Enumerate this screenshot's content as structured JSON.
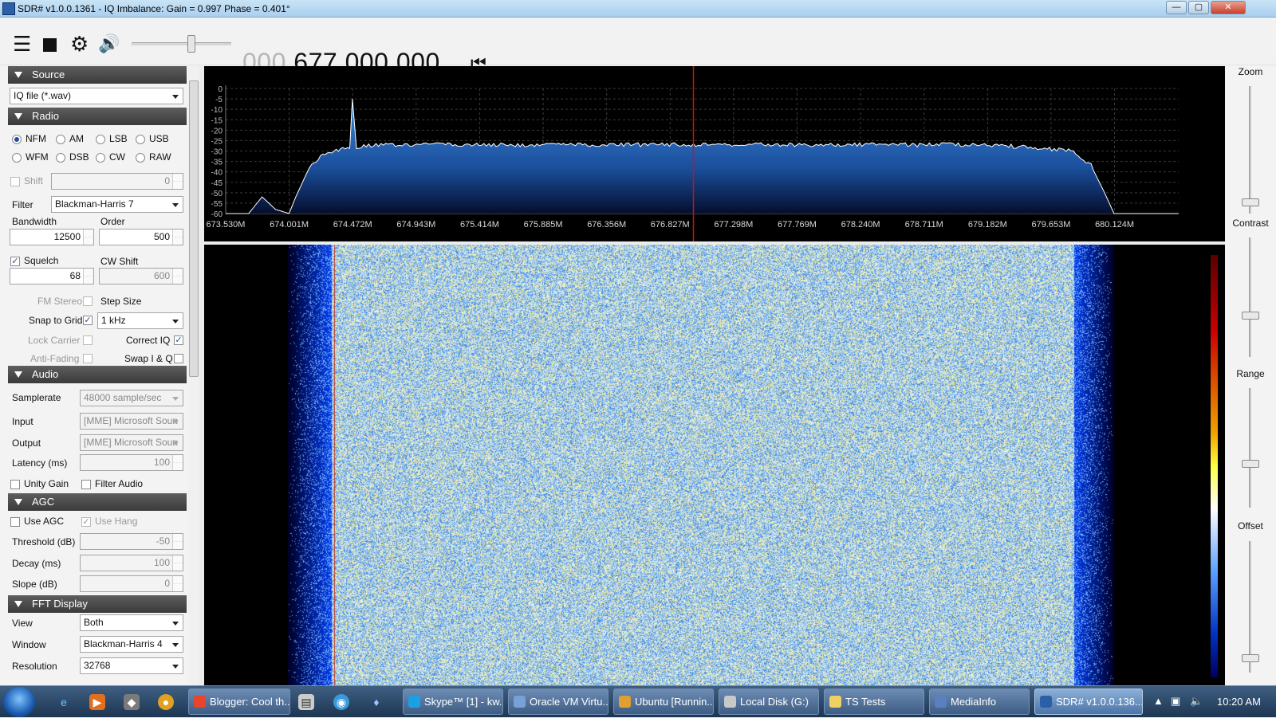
{
  "window": {
    "title": "SDR# v1.0.0.1361 - IQ Imbalance: Gain = 0.997 Phase = 0.401°",
    "min": "—",
    "max": "▢",
    "close": "✕"
  },
  "toolbar": {
    "freq_dim": "000.",
    "freq_main": "677.000.000",
    "volume_level": 0.6
  },
  "source": {
    "header": "Source",
    "device": "IQ file (*.wav)"
  },
  "radio": {
    "header": "Radio",
    "modes": [
      "NFM",
      "AM",
      "LSB",
      "USB",
      "WFM",
      "DSB",
      "CW",
      "RAW"
    ],
    "selected_mode": "NFM",
    "shift_label": "Shift",
    "shift_value": "0",
    "filter_label": "Filter",
    "filter_value": "Blackman-Harris 7",
    "bandwidth_label": "Bandwidth",
    "bandwidth_value": "12500",
    "order_label": "Order",
    "order_value": "500",
    "squelch_label": "Squelch",
    "squelch_value": "68",
    "cwshift_label": "CW Shift",
    "cwshift_value": "600",
    "fmstereo_label": "FM Stereo",
    "stepsize_label": "Step Size",
    "snap_label": "Snap to Grid",
    "step_value": "1 kHz",
    "lockcarrier_label": "Lock Carrier",
    "correctiq_label": "Correct IQ",
    "antifading_label": "Anti-Fading",
    "swapiq_label": "Swap I & Q"
  },
  "audio": {
    "header": "Audio",
    "samplerate_label": "Samplerate",
    "samplerate_value": "48000 sample/sec",
    "input_label": "Input",
    "input_value": "[MME] Microsoft Soun",
    "output_label": "Output",
    "output_value": "[MME] Microsoft Soun",
    "latency_label": "Latency (ms)",
    "latency_value": "100",
    "unitygain_label": "Unity Gain",
    "filteraudio_label": "Filter Audio"
  },
  "agc": {
    "header": "AGC",
    "useagc_label": "Use AGC",
    "usehang_label": "Use Hang",
    "threshold_label": "Threshold (dB)",
    "threshold_value": "-50",
    "decay_label": "Decay (ms)",
    "decay_value": "100",
    "slope_label": "Slope (dB)",
    "slope_value": "0"
  },
  "fft": {
    "header": "FFT Display",
    "view_label": "View",
    "view_value": "Both",
    "window_label": "Window",
    "window_value": "Blackman-Harris 4",
    "resolution_label": "Resolution",
    "resolution_value": "32768"
  },
  "right_panel": {
    "zoom": "Zoom",
    "contrast": "Contrast",
    "range": "Range",
    "offset": "Offset"
  },
  "chart_data": {
    "type": "area",
    "x_ticks": [
      "673.530M",
      "674.001M",
      "674.472M",
      "674.943M",
      "675.414M",
      "675.885M",
      "676.356M",
      "676.827M",
      "677.298M",
      "677.769M",
      "678.240M",
      "678.711M",
      "679.182M",
      "679.653M",
      "680.124M"
    ],
    "y_ticks": [
      "0",
      "-5",
      "-10",
      "-15",
      "-20",
      "-25",
      "-30",
      "-35",
      "-40",
      "-45",
      "-50",
      "-55",
      "-60"
    ],
    "ylim": [
      -60,
      0
    ],
    "xlim": [
      673.53,
      680.6
    ],
    "center_freq": 677.0,
    "series": [
      {
        "x": [
          673.53,
          673.7,
          673.8,
          673.9,
          674.0,
          674.05,
          674.15,
          674.25,
          674.35,
          674.45,
          674.47,
          674.5,
          674.7,
          675.0,
          675.5,
          676.0,
          676.5,
          677.0,
          677.5,
          678.0,
          678.5,
          679.0,
          679.5,
          679.8,
          679.95,
          680.05,
          680.12,
          680.3,
          680.6
        ],
        "y": [
          -60,
          -60,
          -52,
          -58,
          -60,
          -52,
          -38,
          -32,
          -30,
          -28,
          -5,
          -28,
          -27,
          -27,
          -27,
          -27,
          -27,
          -27,
          -27,
          -27,
          -27,
          -27,
          -28,
          -30,
          -37,
          -50,
          -60,
          -60,
          -60
        ]
      }
    ],
    "fill_color": "#1e5fb5",
    "line_color": "#ffffff",
    "grid": true
  },
  "taskbar": {
    "buttons": [
      {
        "label": "Blogger: Cool th...",
        "color": "#e8452c"
      },
      {
        "label": "Skype™ [1] - kw...",
        "color": "#1aa1e3"
      },
      {
        "label": "Oracle VM Virtu...",
        "color": "#7aa0d8"
      },
      {
        "label": "Ubuntu [Runnin...",
        "color": "#e0a030"
      },
      {
        "label": "Local Disk (G:)",
        "color": "#c8c8c8"
      },
      {
        "label": "TS Tests",
        "color": "#f0d060"
      },
      {
        "label": "MediaInfo",
        "color": "#5a80c0"
      },
      {
        "label": "SDR# v1.0.0.136...",
        "color": "#2b5fa6"
      }
    ],
    "clock": "10:20 AM"
  }
}
